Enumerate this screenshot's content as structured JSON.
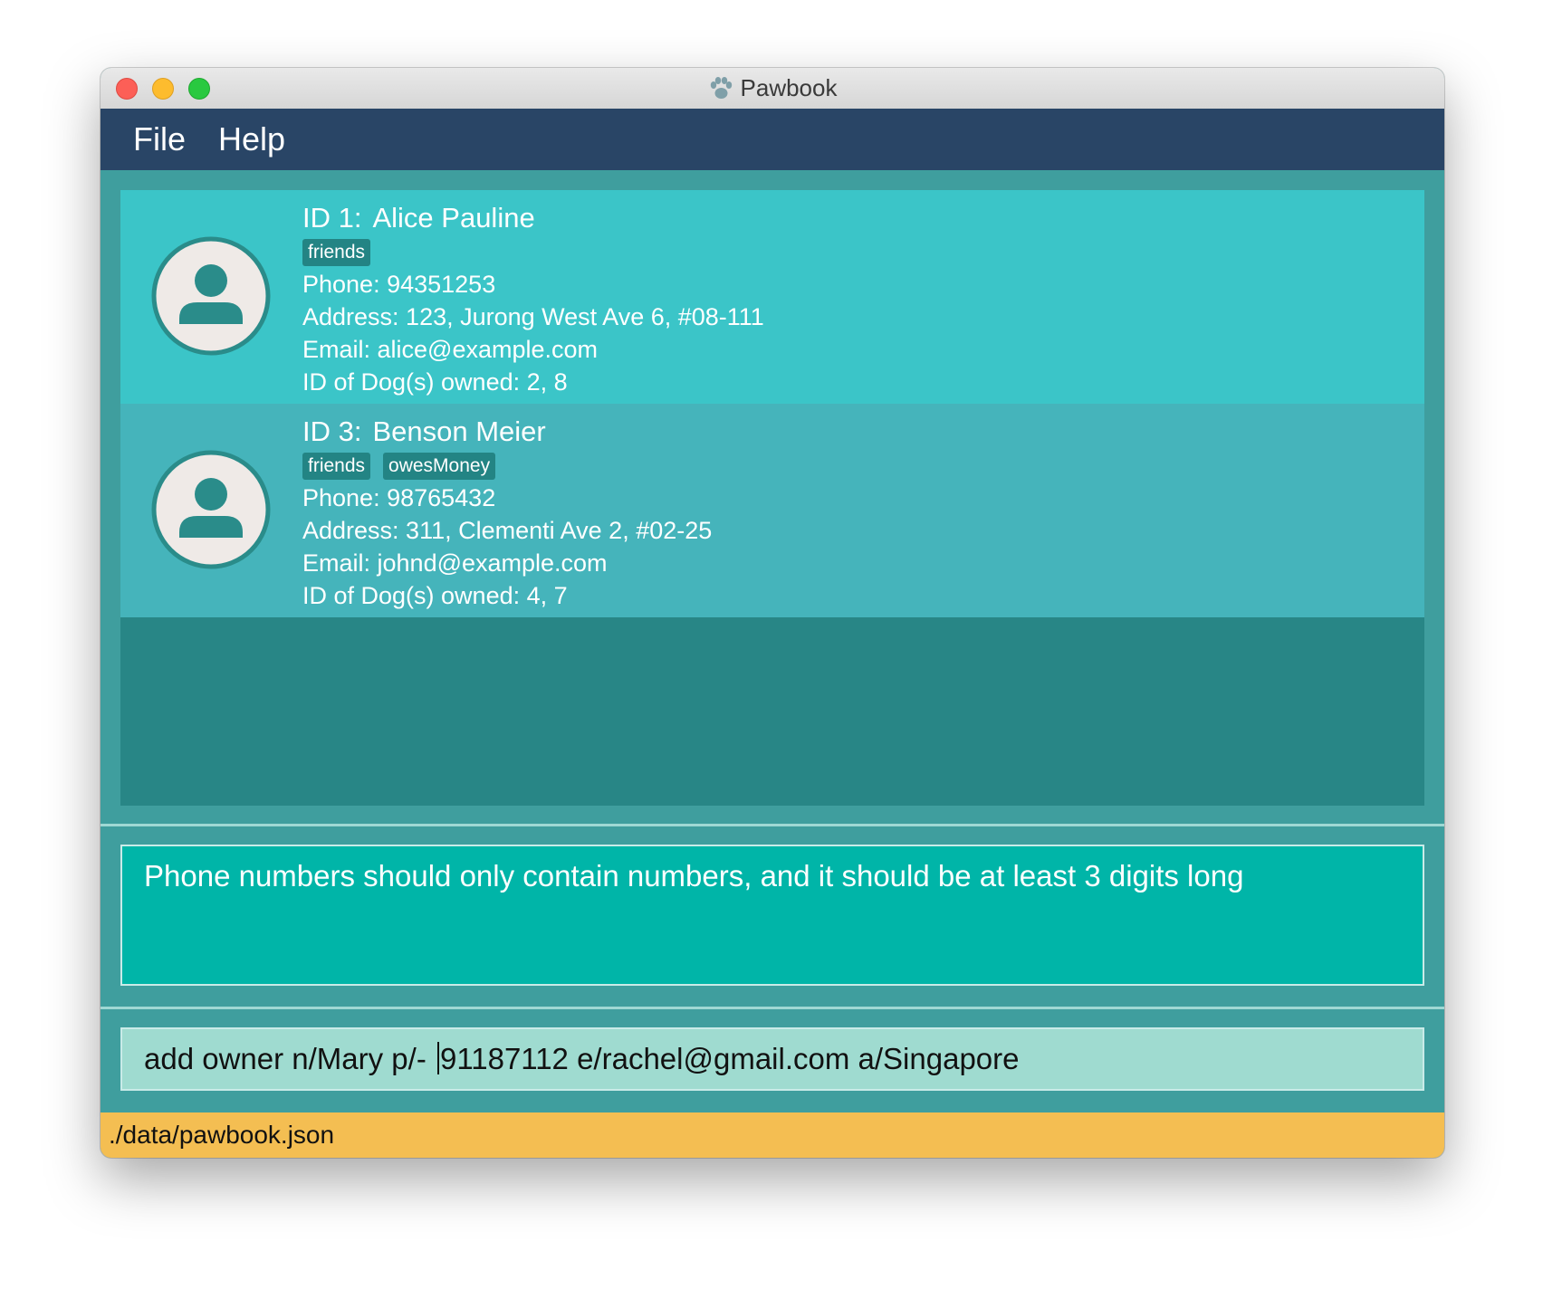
{
  "window": {
    "title": "Pawbook",
    "title_icon": "paw-icon"
  },
  "menu": {
    "items": [
      {
        "label": "File"
      },
      {
        "label": "Help"
      }
    ]
  },
  "owners": [
    {
      "id_label": "ID 1:",
      "name": "Alice Pauline",
      "tags": [
        "friends"
      ],
      "phone": "Phone: 94351253",
      "address": "Address: 123, Jurong West Ave 6, #08-111",
      "email": "Email: alice@example.com",
      "dogs": "ID of Dog(s) owned: 2, 8",
      "avatar_icon": "person-icon"
    },
    {
      "id_label": "ID 3:",
      "name": "Benson Meier",
      "tags": [
        "friends",
        "owesMoney"
      ],
      "phone": "Phone: 98765432",
      "address": "Address: 311, Clementi Ave 2, #02-25",
      "email": "Email: johnd@example.com",
      "dogs": "ID of Dog(s) owned: 4, 7",
      "avatar_icon": "person-icon"
    }
  ],
  "result": {
    "message": "Phone numbers should only contain numbers, and it should be at least 3 digits long"
  },
  "command": {
    "before_caret": "add owner n/Mary p/- ",
    "after_caret": "91187112 e/rachel@gmail.com a/Singapore"
  },
  "status": {
    "file_path": "./data/pawbook.json"
  },
  "colors": {
    "menubar": "#294566",
    "card_selected": "#3bc5c8",
    "card_default": "#45b4bb",
    "list_bg": "#288686",
    "result_bg": "#00b5a8",
    "command_bg": "#9fdbd0",
    "statusbar": "#f4be52",
    "tag": "#238484"
  }
}
